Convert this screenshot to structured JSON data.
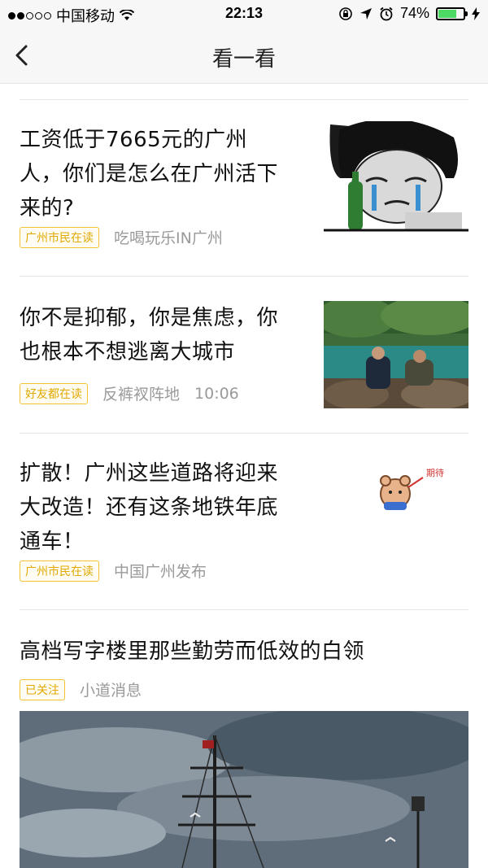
{
  "status_bar": {
    "carrier": "中国移动",
    "time": "22:13",
    "battery_percent": "74%",
    "battery_level": 0.74
  },
  "nav": {
    "title": "看一看"
  },
  "articles": [
    {
      "title_lines": [
        "工资低于7665元的广州",
        "人，你们是怎么在广州活下",
        "来的?"
      ],
      "tag": "广州市民在读",
      "source": "吃喝玩乐IN广州",
      "time": "",
      "thumb": "meme-crying-face"
    },
    {
      "title_lines": [
        "你不是抑郁，你是焦虑，你",
        "也根本不想逃离大城市"
      ],
      "tag": "好友都在读",
      "source": "反裤衩阵地",
      "time": "10:06",
      "thumb": "river-photo"
    },
    {
      "title_lines": [
        "扩散！广州这些道路将迎来",
        "大改造！还有这条地铁年底",
        "通车！"
      ],
      "tag": "广州市民在读",
      "source": "中国广州发布",
      "time": "",
      "thumb": "cartoon-bear-sticker",
      "thumb_text": "期待"
    },
    {
      "title_lines": [
        "高档写字楼里那些勤劳而低效的白领"
      ],
      "tag": "已关注",
      "source": "小道消息",
      "time": "",
      "thumb": "painting-ship-storm"
    }
  ]
}
